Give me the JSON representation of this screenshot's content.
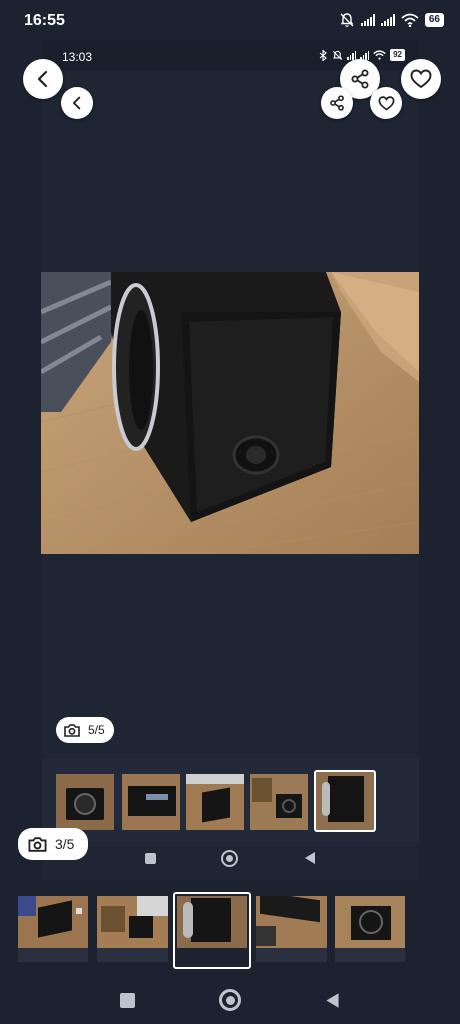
{
  "status_bar": {
    "time": "16:55",
    "battery": "66"
  },
  "nested_status_bar": {
    "time": "13:03",
    "battery": "92"
  },
  "gallery": {
    "nested_counter": "5/5",
    "outer_counter": "3/5"
  },
  "icons": {
    "back": "back-icon",
    "share": "share-icon",
    "favorite": "heart-icon",
    "camera": "camera-icon"
  }
}
